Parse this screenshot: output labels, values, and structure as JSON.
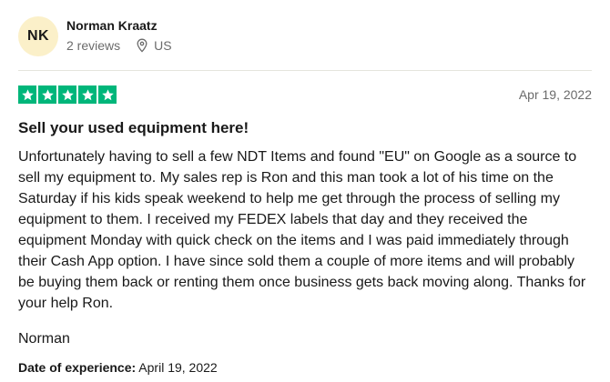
{
  "reviewer": {
    "initials": "NK",
    "name": "Norman Kraatz",
    "reviews_count": "2 reviews",
    "country": "US"
  },
  "review": {
    "rating": 5,
    "max_rating": 5,
    "star_color": "#00b67a",
    "date": "Apr 19, 2022",
    "title": "Sell your used equipment here!",
    "body": "Unfortunately having to sell a few NDT Items and found \"EU\" on Google as a source to sell my equipment to. My sales rep is Ron and this man took a lot of his time on the Saturday if his kids speak weekend to help me get through the process of selling my equipment to them. I received my FEDEX labels that day and they received the equipment Monday with quick check on the items and I was paid immediately through their Cash App option. I have since sold them a couple of more items and will probably be buying them back or renting them once business gets back moving along. Thanks for your help Ron.",
    "signature": "Norman",
    "experience_label": "Date of experience:",
    "experience_date": "April 19, 2022"
  },
  "icons": {
    "location": "location-pin-icon",
    "star": "star-icon"
  }
}
